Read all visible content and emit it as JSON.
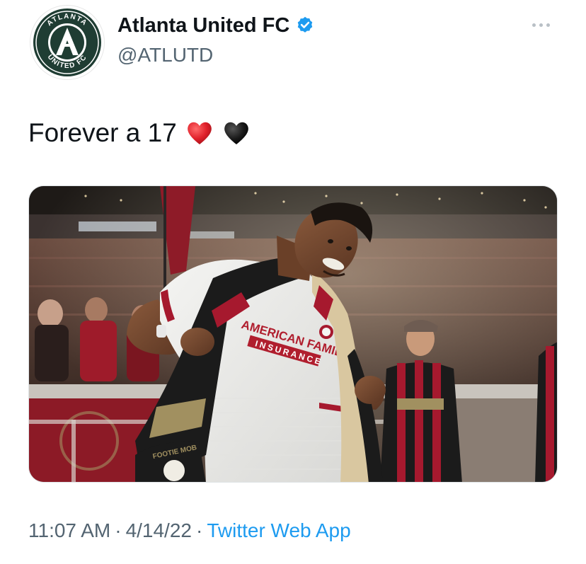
{
  "author": {
    "display_name": "Atlanta United FC",
    "handle": "@ATLUTD",
    "verified": true,
    "avatar_ring_text_top": "ATLANTA",
    "avatar_ring_text_bottom": "UNITED FC"
  },
  "tweet": {
    "text": "Forever a 17",
    "emoji": [
      "red-heart",
      "black-heart"
    ]
  },
  "media": {
    "alt": "Player in white Atlanta United jersey holding a scarf in a stadium",
    "jersey_sponsor_line1": "AMERICAN FAMILY",
    "jersey_sponsor_line2": "INSURANCE",
    "scarf_text": "FOOTIE MOB"
  },
  "meta": {
    "time": "11:07 AM",
    "separator": "·",
    "date": "4/14/22",
    "source": "Twitter Web App"
  },
  "colors": {
    "text": "#0f1419",
    "secondary": "#536471",
    "link": "#1d9bf0",
    "verified": "#1d9bf0",
    "atl_red": "#a6192e",
    "atl_black": "#1a1a1a",
    "atl_gold": "#a19060"
  },
  "icons": {
    "verified": "verified-badge-icon",
    "more": "more-options-icon"
  }
}
